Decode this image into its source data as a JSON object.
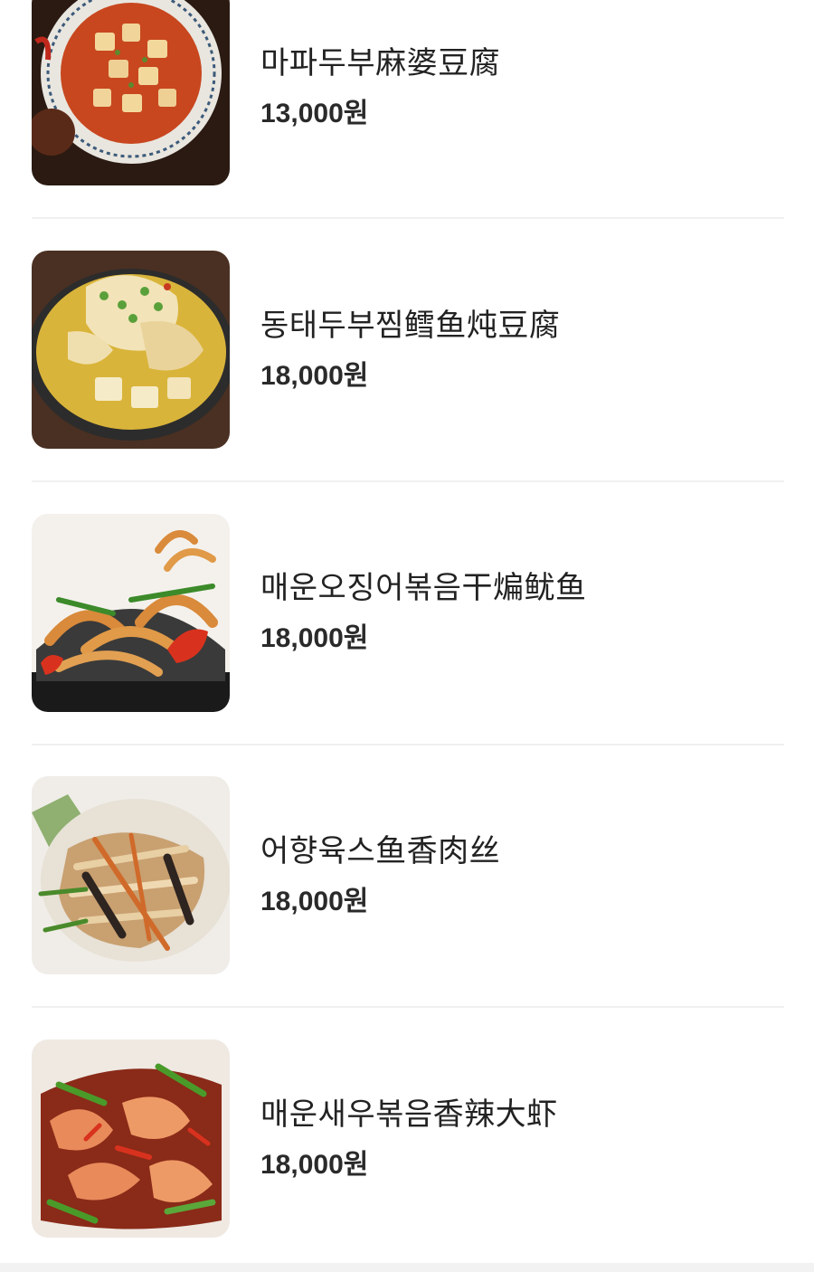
{
  "menu": {
    "items": [
      {
        "name": "마파두부麻婆豆腐",
        "price": "13,000원",
        "image": "mapo-tofu-dish",
        "image_color": "#c8471f"
      },
      {
        "name": "동태두부찜鳕鱼炖豆腐",
        "price": "18,000원",
        "image": "braised-pollock-tofu-dish",
        "image_color": "#d9b43a"
      },
      {
        "name": "매운오징어볶음干煸鱿鱼",
        "price": "18,000원",
        "image": "spicy-squid-stir-fry-dish",
        "image_color": "#d98a3a"
      },
      {
        "name": "어향육스鱼香肉丝",
        "price": "18,000원",
        "image": "fish-flavored-pork-dish",
        "image_color": "#c9a070"
      },
      {
        "name": "매운새우볶음香辣大虾",
        "price": "18,000원",
        "image": "spicy-shrimp-stir-fry-dish",
        "image_color": "#c8502a"
      }
    ]
  },
  "colors": {
    "text": "#222222",
    "divider": "#f0f0f0",
    "background": "#ffffff"
  }
}
